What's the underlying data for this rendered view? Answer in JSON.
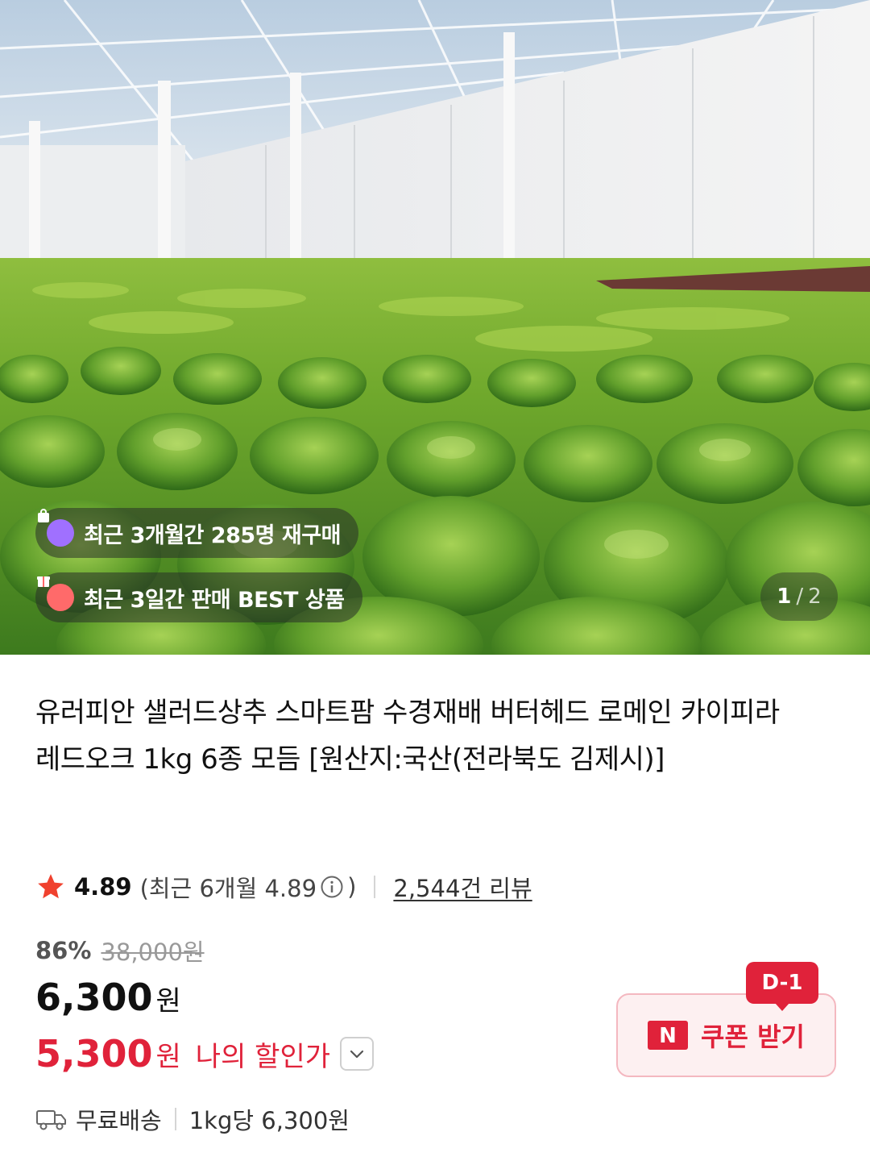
{
  "hero": {
    "badges": [
      {
        "icon": "shopping-bag-icon",
        "text": "최근 3개월간 285명 재구매",
        "icon_color": "#a070ff"
      },
      {
        "icon": "gift-icon",
        "text": "최근 3일간 판매 BEST 상품",
        "icon_color": "#ff6a6a"
      }
    ],
    "page_indicator": {
      "current": "1",
      "separator": "/",
      "total": "2"
    }
  },
  "product": {
    "title": "유러피안 샐러드상추 스마트팜 수경재배 버터헤드 로메인 카이피라 레드오크 1kg 6종 모듬 [원산지:국산(전라북도 김제시)]",
    "rating": {
      "score": "4.89",
      "recent_prefix": "(최근 6개월 4.89",
      "recent_suffix": ")",
      "reviews": "2,544건 리뷰",
      "star_color": "#f0412e"
    },
    "discount": {
      "percent": "86%",
      "original_price": "38,000원"
    },
    "price": {
      "value": "6,300",
      "unit": "원"
    },
    "my_price": {
      "value": "5,300",
      "unit": "원",
      "label": "나의 할인가",
      "color": "#e0223a"
    },
    "coupon": {
      "dday": "D-1",
      "label": "쿠폰 받기",
      "logo": "N"
    },
    "shipping": {
      "label": "무료배송",
      "unit_price": "1kg당 6,300원"
    }
  }
}
